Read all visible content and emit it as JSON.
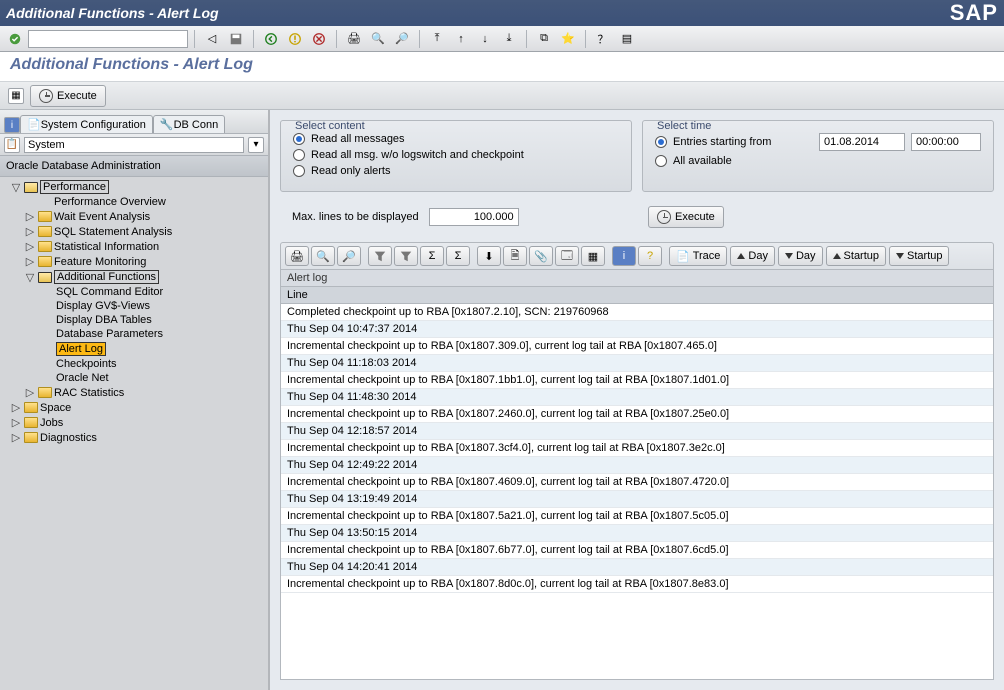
{
  "window": {
    "title": "Additional Functions - Alert Log",
    "brand": "SAP"
  },
  "page_title": "Additional Functions - Alert Log",
  "sec_toolbar": {
    "execute_label": "Execute"
  },
  "left": {
    "tabs": [
      "System Configuration",
      "DB Conn"
    ],
    "system_label": "System",
    "tree_header": "Oracle Database Administration",
    "performance": {
      "label": "Performance",
      "overview": "Performance Overview",
      "wait": "Wait Event Analysis",
      "sql": "SQL Statement Analysis",
      "stat": "Statistical Information",
      "feature": "Feature Monitoring",
      "addl": {
        "label": "Additional Functions",
        "items": [
          "SQL Command Editor",
          "Display GV$-Views",
          "Display DBA Tables",
          "Database Parameters",
          "Alert Log",
          "Checkpoints",
          "Oracle Net"
        ],
        "rac": "RAC Statistics"
      }
    },
    "space": "Space",
    "jobs": "Jobs",
    "diag": "Diagnostics"
  },
  "select_content": {
    "legend": "Select content",
    "opts": [
      "Read all messages",
      "Read all msg. w/o logswitch and checkpoint",
      "Read only alerts"
    ],
    "selected_index": 0
  },
  "select_time": {
    "legend": "Select time",
    "opts": [
      "Entries starting from",
      "All available"
    ],
    "selected_index": 0,
    "date": "01.08.2014",
    "time": "00:00:00"
  },
  "max_lines": {
    "label": "Max. lines to be displayed",
    "value": "100.000"
  },
  "execute_label": "Execute",
  "alert_toolbar": {
    "trace": "Trace",
    "day": "Day",
    "startup": "Startup"
  },
  "grid": {
    "title": "Alert log",
    "column": "Line",
    "rows": [
      "Completed checkpoint up to RBA [0x1807.2.10], SCN: 219760968",
      "Thu Sep 04 10:47:37 2014",
      "Incremental checkpoint up to RBA [0x1807.309.0], current log tail at RBA [0x1807.465.0]",
      "Thu Sep 04 11:18:03 2014",
      "Incremental checkpoint up to RBA [0x1807.1bb1.0], current log tail at RBA [0x1807.1d01.0]",
      "Thu Sep 04 11:48:30 2014",
      "Incremental checkpoint up to RBA [0x1807.2460.0], current log tail at RBA [0x1807.25e0.0]",
      "Thu Sep 04 12:18:57 2014",
      "Incremental checkpoint up to RBA [0x1807.3cf4.0], current log tail at RBA [0x1807.3e2c.0]",
      "Thu Sep 04 12:49:22 2014",
      "Incremental checkpoint up to RBA [0x1807.4609.0], current log tail at RBA [0x1807.4720.0]",
      "Thu Sep 04 13:19:49 2014",
      "Incremental checkpoint up to RBA [0x1807.5a21.0], current log tail at RBA [0x1807.5c05.0]",
      "Thu Sep 04 13:50:15 2014",
      "Incremental checkpoint up to RBA [0x1807.6b77.0], current log tail at RBA [0x1807.6cd5.0]",
      "Thu Sep 04 14:20:41 2014",
      "Incremental checkpoint up to RBA [0x1807.8d0c.0], current log tail at RBA [0x1807.8e83.0]"
    ]
  }
}
